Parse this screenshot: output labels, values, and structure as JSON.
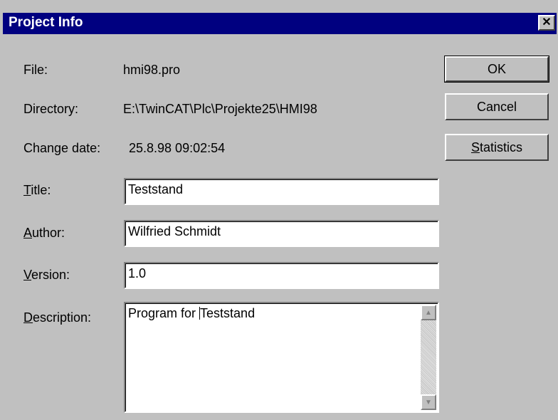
{
  "window": {
    "title": "Project Info",
    "close_glyph": "✕"
  },
  "info": {
    "file_label": "File:",
    "file_value": "hmi98.pro",
    "directory_label": "Directory:",
    "directory_value": "E:\\TwinCAT\\Plc\\Projekte25\\HMI98",
    "change_date_label": "Change date:",
    "change_date_value": "25.8.98 09:02:54"
  },
  "form": {
    "title_label_mnemonic": "T",
    "title_label_rest": "itle:",
    "title_value": "Teststand",
    "author_label_mnemonic": "A",
    "author_label_rest": "uthor:",
    "author_value": "Wilfried Schmidt",
    "version_label_mnemonic": "V",
    "version_label_rest": "ersion:",
    "version_value": "1.0",
    "description_label_mnemonic": "D",
    "description_label_rest": "escription:",
    "description_value_before_caret": "Program for ",
    "description_value_after_caret": "Teststand"
  },
  "buttons": {
    "ok_label": "OK",
    "cancel_label": "Cancel",
    "statistics_mnemonic": "S",
    "statistics_rest": "tatistics"
  },
  "icons": {
    "close": "close-icon",
    "scroll_up": "scroll-up-arrow-icon",
    "scroll_down": "scroll-down-arrow-icon"
  },
  "colors": {
    "titlebar": "#000080",
    "face": "#c0c0c0",
    "field": "#ffffff"
  }
}
